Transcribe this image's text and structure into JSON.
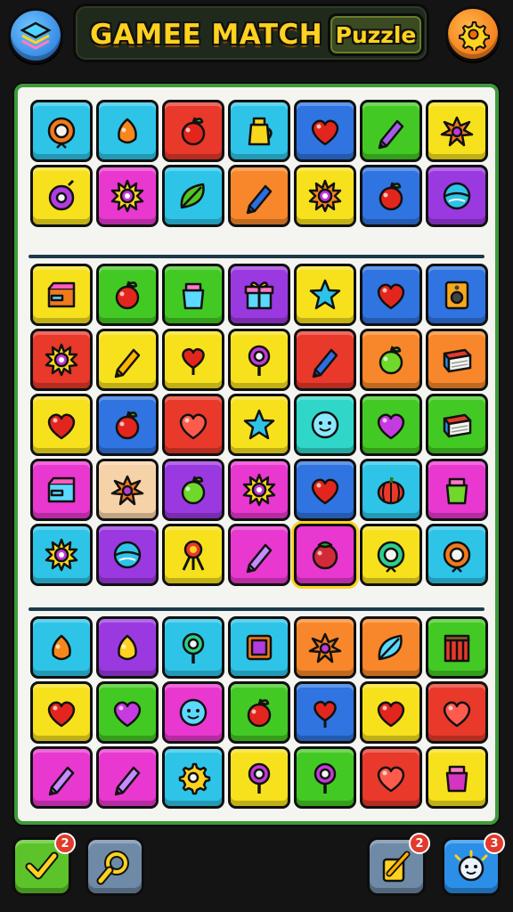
{
  "header": {
    "title": "GAMEE MATCH",
    "badge": "Puzzle",
    "menu_icon": "layers-icon",
    "settings_icon": "gear-icon"
  },
  "colors": {
    "cyan": "#2ec4e8",
    "yellow": "#f7e11d",
    "red": "#e8392b",
    "blue": "#2f74e0",
    "green": "#43c924",
    "orange": "#f7872a",
    "magenta": "#e838cf",
    "purple": "#9b39e0",
    "peach": "#f6d2a8",
    "teal": "#30d7c9",
    "board_border": "#3f9a3a",
    "title": "#ffd21f"
  },
  "board": {
    "sections": [
      {
        "rows": [
          [
            {
              "c": "cyan",
              "i": "flower-gear"
            },
            {
              "c": "cyan",
              "i": "lemon"
            },
            {
              "c": "red",
              "i": "apple"
            },
            {
              "c": "cyan",
              "i": "jug"
            },
            {
              "c": "blue",
              "i": "heart"
            },
            {
              "c": "green",
              "i": "pencil"
            },
            {
              "c": "yellow",
              "i": "splat"
            }
          ],
          [
            {
              "c": "yellow",
              "i": "ring"
            },
            {
              "c": "magenta",
              "i": "sunburst"
            },
            {
              "c": "cyan",
              "i": "leaf"
            },
            {
              "c": "orange",
              "i": "pencil"
            },
            {
              "c": "yellow",
              "i": "sunburst"
            },
            {
              "c": "blue",
              "i": "apple"
            },
            {
              "c": "purple",
              "i": "disc"
            }
          ]
        ]
      },
      {
        "rows": [
          [
            {
              "c": "yellow",
              "i": "box"
            },
            {
              "c": "green",
              "i": "apple"
            },
            {
              "c": "green",
              "i": "jar"
            },
            {
              "c": "purple",
              "i": "gift"
            },
            {
              "c": "yellow",
              "i": "star"
            },
            {
              "c": "blue",
              "i": "heart"
            },
            {
              "c": "blue",
              "i": "speaker"
            }
          ],
          [
            {
              "c": "red",
              "i": "sunburst"
            },
            {
              "c": "yellow",
              "i": "pencil"
            },
            {
              "c": "yellow",
              "i": "heart-pin"
            },
            {
              "c": "yellow",
              "i": "lollipop"
            },
            {
              "c": "red",
              "i": "pencil"
            },
            {
              "c": "orange",
              "i": "apple"
            },
            {
              "c": "orange",
              "i": "book"
            }
          ],
          [
            {
              "c": "yellow",
              "i": "heart"
            },
            {
              "c": "blue",
              "i": "apple"
            },
            {
              "c": "red",
              "i": "heart"
            },
            {
              "c": "yellow",
              "i": "star"
            },
            {
              "c": "teal",
              "i": "face"
            },
            {
              "c": "green",
              "i": "heart"
            },
            {
              "c": "green",
              "i": "book"
            }
          ],
          [
            {
              "c": "magenta",
              "i": "box"
            },
            {
              "c": "peach",
              "i": "splat"
            },
            {
              "c": "purple",
              "i": "apple"
            },
            {
              "c": "magenta",
              "i": "sunburst"
            },
            {
              "c": "blue",
              "i": "heart"
            },
            {
              "c": "cyan",
              "i": "pumpkin"
            },
            {
              "c": "magenta",
              "i": "jar"
            }
          ],
          [
            {
              "c": "cyan",
              "i": "sunburst"
            },
            {
              "c": "purple",
              "i": "disc"
            },
            {
              "c": "yellow",
              "i": "trophy"
            },
            {
              "c": "magenta",
              "i": "pencil"
            },
            {
              "c": "magenta",
              "i": "berry",
              "sel": true
            },
            {
              "c": "yellow",
              "i": "flower-gear"
            },
            {
              "c": "cyan",
              "i": "flower-gear"
            }
          ]
        ]
      },
      {
        "rows": [
          [
            {
              "c": "cyan",
              "i": "lemon"
            },
            {
              "c": "purple",
              "i": "lemon"
            },
            {
              "c": "cyan",
              "i": "lollipop"
            },
            {
              "c": "cyan",
              "i": "frame"
            },
            {
              "c": "orange",
              "i": "splat"
            },
            {
              "c": "orange",
              "i": "leaf"
            },
            {
              "c": "green",
              "i": "crate"
            }
          ],
          [
            {
              "c": "yellow",
              "i": "heart"
            },
            {
              "c": "green",
              "i": "heart"
            },
            {
              "c": "magenta",
              "i": "face"
            },
            {
              "c": "green",
              "i": "apple"
            },
            {
              "c": "blue",
              "i": "heart-pin"
            },
            {
              "c": "yellow",
              "i": "heart"
            },
            {
              "c": "red",
              "i": "heart"
            }
          ],
          [
            {
              "c": "magenta",
              "i": "pencil"
            },
            {
              "c": "magenta",
              "i": "pencil"
            },
            {
              "c": "cyan",
              "i": "gear"
            },
            {
              "c": "yellow",
              "i": "lollipop"
            },
            {
              "c": "green",
              "i": "lollipop"
            },
            {
              "c": "red",
              "i": "heart"
            },
            {
              "c": "yellow",
              "i": "jar"
            }
          ]
        ]
      }
    ]
  },
  "footer": {
    "buttons": [
      {
        "name": "check-button",
        "icon": "checkmark-icon",
        "badge": "2"
      },
      {
        "name": "hint-button",
        "icon": "magnifier-icon",
        "badge": ""
      },
      {
        "name": "shuffle-button",
        "icon": "shuffle-icon",
        "badge": "2"
      },
      {
        "name": "bomb-button",
        "icon": "bomb-icon",
        "badge": "3"
      }
    ]
  }
}
